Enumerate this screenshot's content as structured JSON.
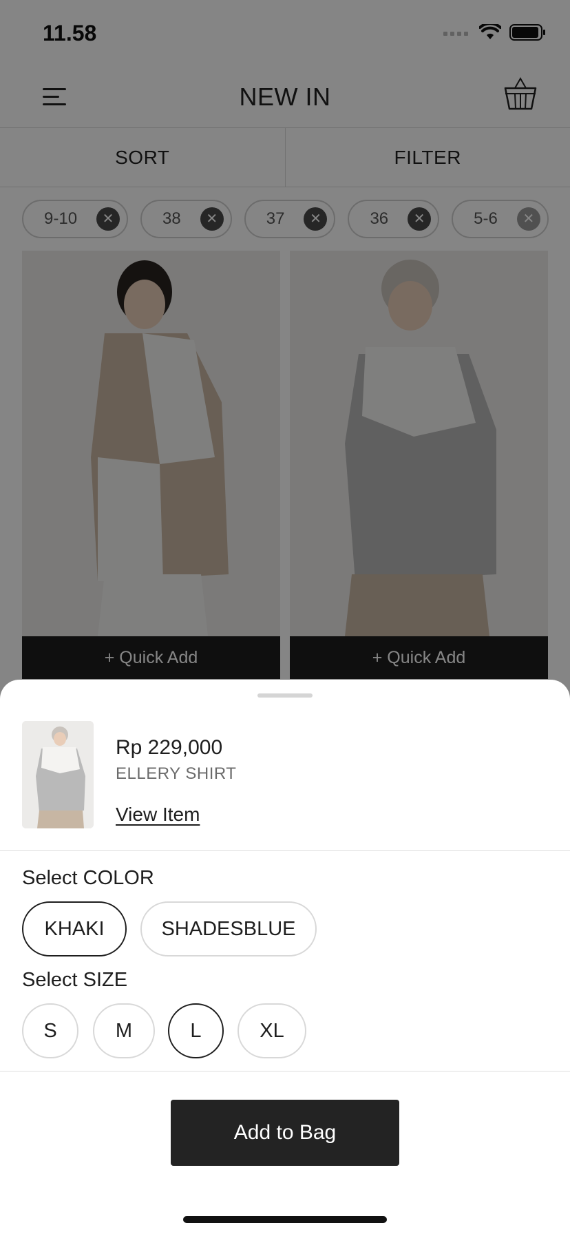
{
  "status_bar": {
    "time": "11.58"
  },
  "header": {
    "title": "NEW IN"
  },
  "sort_label": "SORT",
  "filter_label": "FILTER",
  "filter_chips": [
    {
      "label": "9-10"
    },
    {
      "label": "38"
    },
    {
      "label": "37"
    },
    {
      "label": "36"
    },
    {
      "label": "5-6"
    }
  ],
  "products": [
    {
      "quick_add_label": "+ Quick Add",
      "photo_colors": [
        "#c9b7a3",
        "#f3f3f1",
        "#2a2320"
      ]
    },
    {
      "quick_add_label": "+ Quick Add",
      "photo_colors": [
        "#b9b9b9",
        "#f4f3f1",
        "#2a2320"
      ]
    }
  ],
  "sheet": {
    "price": "Rp 229,000",
    "product_name": "ELLERY SHIRT",
    "view_item_label": "View Item",
    "color_label": "Select COLOR",
    "colors": [
      {
        "label": "KHAKI",
        "selected": true
      },
      {
        "label": "SHADESBLUE",
        "selected": false
      }
    ],
    "size_label": "Select SIZE",
    "sizes": [
      {
        "label": "S",
        "selected": false
      },
      {
        "label": "M",
        "selected": false
      },
      {
        "label": "L",
        "selected": true
      },
      {
        "label": "XL",
        "selected": false
      }
    ],
    "add_to_bag_label": "Add to Bag"
  },
  "icons": {
    "menu": "hamburger-menu-icon",
    "basket": "shopping-basket-icon",
    "chip_remove": "close-icon",
    "signal": "cellular-signal-icon",
    "wifi": "wifi-icon",
    "battery": "battery-icon"
  },
  "colors": {
    "dark_button": "#232323",
    "quick_add_bar": "#1e1e1e",
    "overlay": "rgba(0,0,0,0.48)"
  }
}
